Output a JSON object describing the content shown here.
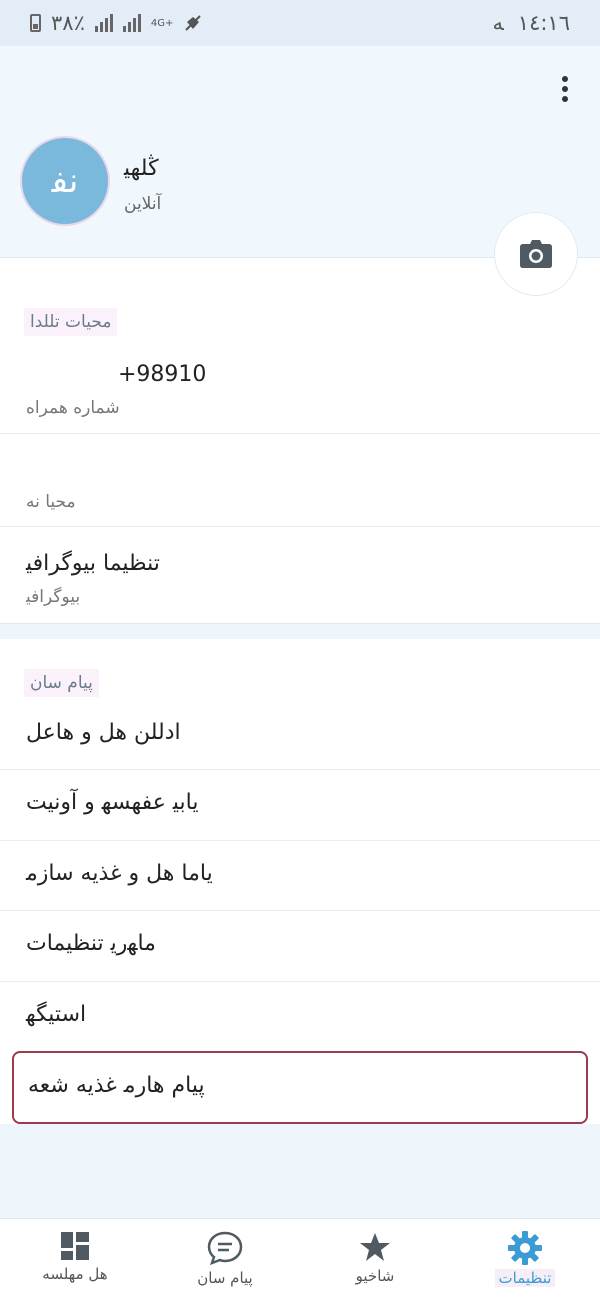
{
  "status_bar": {
    "time": "١٤:١٦",
    "time_suffix": "ﻪ",
    "battery": "٣٨٪",
    "network": "4G+"
  },
  "header": {
    "profile_name": "ﯕﻠﻬﻴ",
    "profile_status": "ﺁﻧﻼﻳﻦ",
    "avatar_initials": "ﻧﻔ"
  },
  "account": {
    "section_title": "ﻣﺤﻴﺎﺕ ﺗﻠﻠﺪﺍ",
    "phone": "+98910",
    "phone_hint": "ﺷﻤﺎﺭﻩ ﻫﻤﺮﺍﻩ",
    "username_hint": "ﻣﺤﻴﺎ ﻧﻪ",
    "bio_value": "ﺗﻨﻈﻴﻤﺎ ﺑﻴﻮﮔﺮﺍﻓﻴ",
    "bio_hint": "ﺑﻴﻮﮔﺮﺍﻓﻴ"
  },
  "settings": {
    "section_title": "ﭘﻴﺎﻡ ﺳﺎﻥ",
    "items": [
      {
        "label": "ﺍﺩﻟﻠﻦ ﻫﻞ ﻭ ﻫﺎﻋﻞ"
      },
      {
        "label": "ﻳﺎﺑﻴ ﻋﻔﻬﺴﻬ ﻭ ﺁﻭﻧﻴﺖ"
      },
      {
        "label": "ﻳﺎﻣﺎ ﻫﻞ ﻭ ﻏﺬﻳﻪ ﺳﺎﺯﻣ"
      },
      {
        "label": "ﻣﺎﻬﺭﻳ ﺗﻨﻈﻴﻤﺎﺕ"
      },
      {
        "label": "ﺍﺳﺘﻴﮕﻬ"
      },
      {
        "label": "ﭘﻴﺎﻡ ﻫﺎﺭﻣ ﻏﺬﻳﻪ ﺷﻌﻪ"
      }
    ]
  },
  "bottom_nav": {
    "items": [
      {
        "label": "ﻫﻞ ﻣﻬﻠﺴﻪ"
      },
      {
        "label": "ﭘﻴﺎﻡ ﺳﺎﻥ"
      },
      {
        "label": "ﺷﺎﺧﻴﻮ"
      },
      {
        "label": "ﺗﻨﻈﻴﻤﺎﺕ"
      }
    ],
    "active_index": 3
  },
  "colors": {
    "accent": "#3a9bd5",
    "avatar_bg": "#7bb9dc",
    "highlight_border": "#9c3b50",
    "icon_gray": "#4f5a63"
  }
}
